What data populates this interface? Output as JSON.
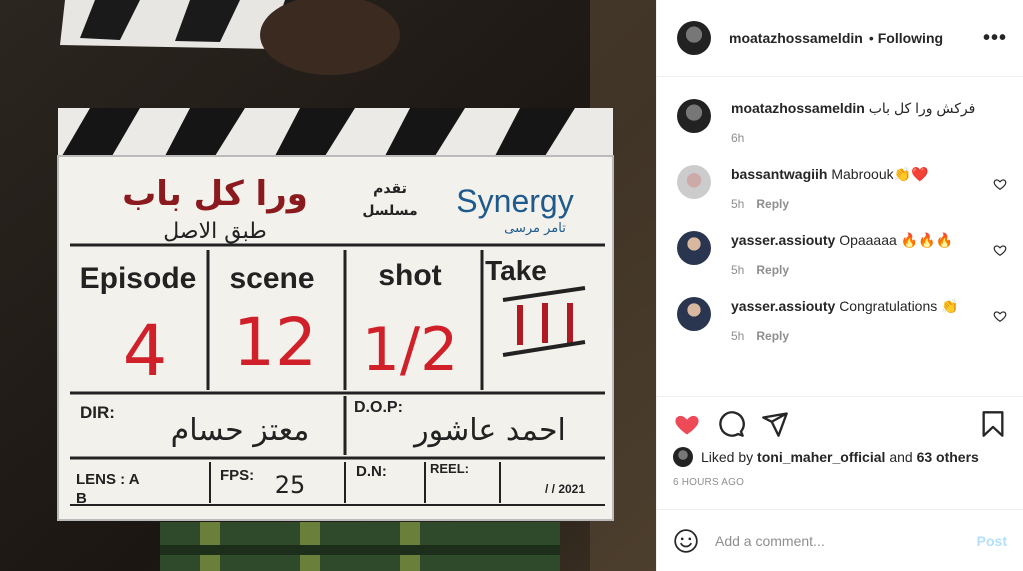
{
  "photo": {
    "clapper_title": "ورا كل باب",
    "clapper_subtitle": "طبق الاصل",
    "clapper_present": "تقدم",
    "clapper_series": "مسلسل",
    "brand": "Synergy",
    "brand_sub": "تامر مرسى",
    "labels": [
      "Episode",
      "scene",
      "shot",
      "Take"
    ],
    "episode": "4",
    "scene": "12",
    "shot": "1/2",
    "dir_label": "DIR:",
    "dir_value": "معتز حسام",
    "dop_label": "D.O.P:",
    "dop_value": "احمد عاشور",
    "lens_label": "LENS : A",
    "lens_b": "B",
    "fps_label": "FPS:",
    "fps_value": "25",
    "dn_label": "D.N:",
    "reel_label": "REEL:",
    "date": "/ / 2021"
  },
  "header": {
    "username": "moatazhossameldin",
    "dot": "•",
    "follow_status": "Following",
    "more": "•••"
  },
  "caption": {
    "username": "moatazhossameldin",
    "text": "فركش ورا كل باب",
    "time": "6h"
  },
  "comments": [
    {
      "username": "bassantwagiih",
      "text": "Mabroouk👏❤️",
      "time": "5h",
      "reply": "Reply"
    },
    {
      "username": "yasser.assiouty",
      "text": "Opaaaaa 🔥🔥🔥",
      "time": "5h",
      "reply": "Reply"
    },
    {
      "username": "yasser.assiouty",
      "text": "Congratulations 👏",
      "time": "5h",
      "reply": "Reply"
    }
  ],
  "likes": {
    "prefix": "Liked by",
    "user": "toni_maher_official",
    "middle": "and",
    "others": "63 others"
  },
  "time_ago": "6 HOURS AGO",
  "comment_box": {
    "placeholder": "Add a comment...",
    "post_label": "Post"
  },
  "colors": {
    "like_red": "#ed4956",
    "post_blue": "#b2dffc"
  }
}
